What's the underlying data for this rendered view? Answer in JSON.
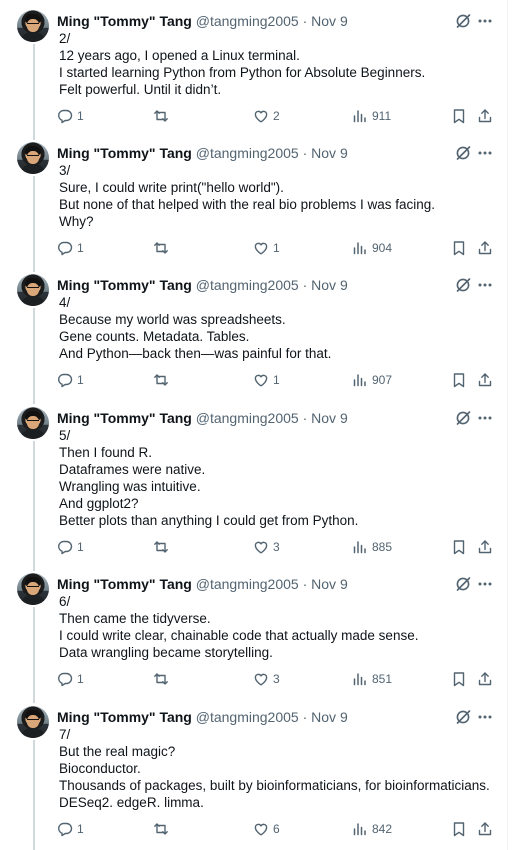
{
  "author": {
    "name": "Ming \"Tommy\" Tang",
    "handle": "@tangming2005",
    "separator": "·",
    "date": "Nov 9"
  },
  "icons": {
    "reply": "reply-icon",
    "retweet": "retweet-icon",
    "like": "heart-icon",
    "views": "views-icon",
    "bookmark": "bookmark-icon",
    "share": "share-icon",
    "grok": "grok-icon",
    "more": "more-icon"
  },
  "colors": {
    "text": "#0f1419",
    "muted": "#536471",
    "thread_line": "#cfd9de"
  },
  "tweets": [
    {
      "lines": [
        "2/",
        "12 years ago, I opened a Linux terminal.",
        "I started learning Python from Python for Absolute Beginners.",
        "Felt powerful. Until it didn’t."
      ],
      "replies": "1",
      "retweets": "",
      "likes": "2",
      "views": "911"
    },
    {
      "lines": [
        "3/",
        "Sure, I could write print(\"hello world\").",
        "But none of that helped with the real bio problems I was facing.",
        "Why?"
      ],
      "replies": "1",
      "retweets": "",
      "likes": "1",
      "views": "904"
    },
    {
      "lines": [
        "4/",
        "Because my world was spreadsheets.",
        "Gene counts. Metadata. Tables.",
        "And Python—back then—was painful for that."
      ],
      "replies": "1",
      "retweets": "",
      "likes": "1",
      "views": "907"
    },
    {
      "lines": [
        "5/",
        "Then I found R.",
        "Dataframes were native.",
        "Wrangling was intuitive.",
        "And ggplot2?",
        "Better plots than anything I could get from Python."
      ],
      "replies": "1",
      "retweets": "",
      "likes": "3",
      "views": "885"
    },
    {
      "lines": [
        "6/",
        "Then came the tidyverse.",
        "I could write clear, chainable code that actually made sense.",
        "Data wrangling became storytelling."
      ],
      "replies": "1",
      "retweets": "",
      "likes": "3",
      "views": "851"
    },
    {
      "lines": [
        "7/",
        "But the real magic?",
        "Bioconductor.",
        "Thousands of packages, built by bioinformaticians, for bioinformaticians.",
        "DESeq2. edgeR. limma."
      ],
      "replies": "1",
      "retweets": "",
      "likes": "6",
      "views": "842"
    }
  ]
}
